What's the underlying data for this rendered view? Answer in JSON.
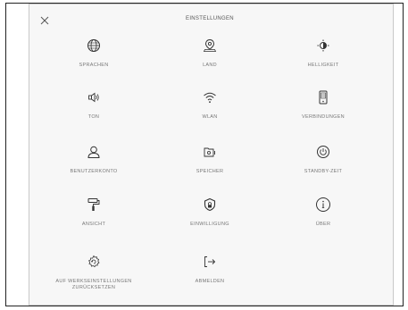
{
  "header": {
    "title": "EINSTELLUNGEN",
    "close_icon": "close-icon"
  },
  "tiles": [
    {
      "label": "SPRACHEN",
      "icon": "globe-icon"
    },
    {
      "label": "LAND",
      "icon": "location-pin-icon"
    },
    {
      "label": "HELLIGKEIT",
      "icon": "brightness-icon"
    },
    {
      "label": "TON",
      "icon": "speaker-icon"
    },
    {
      "label": "WLAN",
      "icon": "wifi-icon"
    },
    {
      "label": "VERBINDUNGEN",
      "icon": "phone-connect-icon"
    },
    {
      "label": "BENUTZERKONTO",
      "icon": "user-icon"
    },
    {
      "label": "SPEICHER",
      "icon": "storage-icon"
    },
    {
      "label": "STANDBY-ZEIT",
      "icon": "power-icon"
    },
    {
      "label": "ANSICHT",
      "icon": "paint-roller-icon"
    },
    {
      "label": "EINWILLIGUNG",
      "icon": "shield-icon"
    },
    {
      "label": "ÜBER",
      "icon": "info-icon"
    },
    {
      "label": "AUF WERKSEINSTELLUNGEN ZURÜCKSETZEN",
      "icon": "factory-reset-icon"
    },
    {
      "label": "ABMELDEN",
      "icon": "logout-icon"
    }
  ]
}
